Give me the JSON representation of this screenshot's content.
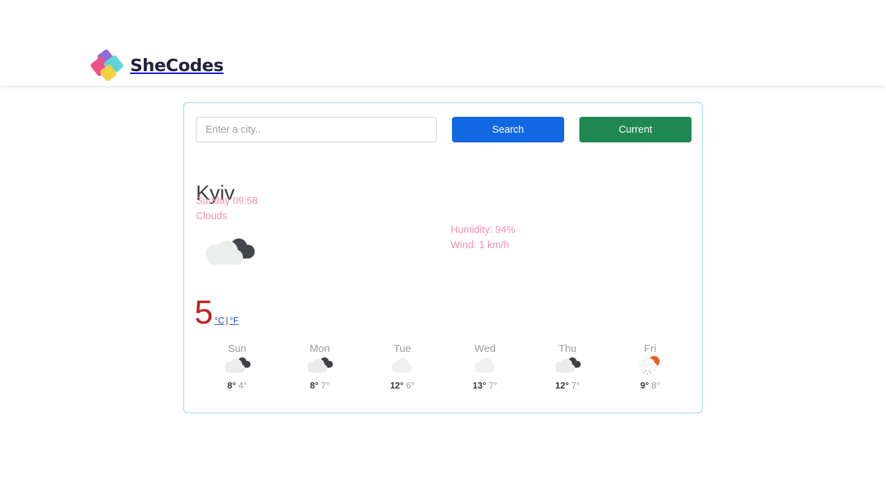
{
  "header": {
    "brand_name": "SheCodes",
    "logo_icon": "shecodes-diamonds-logo",
    "logo_colors": {
      "purple": "#8d6fd6",
      "pink": "#ee4f8b",
      "cyan": "#5ed4d9",
      "yellow": "#f7cf43"
    }
  },
  "search": {
    "placeholder": "Enter a city..",
    "value": "",
    "search_label": "Search",
    "current_label": "Current",
    "search_color": "#1268e3",
    "current_color": "#1e8850"
  },
  "current": {
    "city": "Kyiv",
    "datetime": "Sunday 09:58",
    "description": "Clouds",
    "humidity": "Humidity: 94%",
    "wind": "Wind: 1 km/h",
    "icon": "broken-clouds-icon",
    "temperature": "5",
    "unit_celsius": "°C",
    "unit_separator": "|",
    "unit_fahrenheit": "°F",
    "accent_color": "#f28fb3",
    "temperature_color": "#c0231f",
    "card_border_color": "#8fd8dd"
  },
  "forecast": [
    {
      "day": "Sun",
      "icon": "broken-clouds-icon",
      "max": "8°",
      "min": "4°"
    },
    {
      "day": "Mon",
      "icon": "broken-clouds-icon",
      "max": "8°",
      "min": "7°"
    },
    {
      "day": "Tue",
      "icon": "scattered-clouds-icon",
      "max": "12°",
      "min": "6°"
    },
    {
      "day": "Wed",
      "icon": "scattered-clouds-icon",
      "max": "13°",
      "min": "7°"
    },
    {
      "day": "Thu",
      "icon": "broken-clouds-icon",
      "max": "12°",
      "min": "7°"
    },
    {
      "day": "Fri",
      "icon": "sun-rain-icon",
      "max": "9°",
      "min": "8°"
    }
  ]
}
